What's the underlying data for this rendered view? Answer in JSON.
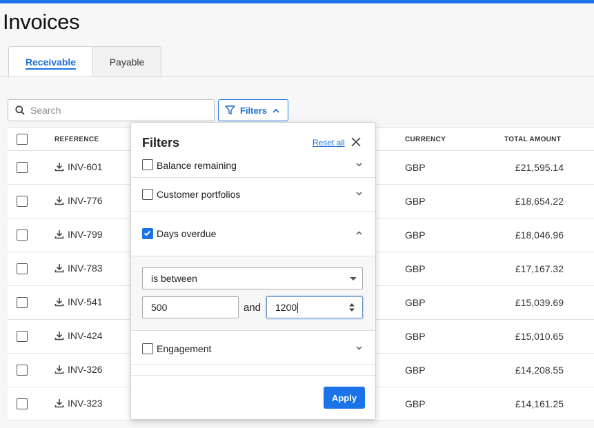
{
  "page": {
    "title": "Invoices"
  },
  "tabs": [
    {
      "label": "Receivable",
      "active": true
    },
    {
      "label": "Payable",
      "active": false
    }
  ],
  "toolbar": {
    "search_placeholder": "Search",
    "filters_label": "Filters"
  },
  "table": {
    "headers": {
      "reference": "REFERENCE",
      "currency": "CURRENCY",
      "total": "TOTAL AMOUNT"
    },
    "rows": [
      {
        "ref": "INV-601",
        "currency": "GBP",
        "amount": "£21,595.14"
      },
      {
        "ref": "INV-776",
        "currency": "GBP",
        "amount": "£18,654.22"
      },
      {
        "ref": "INV-799",
        "currency": "GBP",
        "amount": "£18,046.96"
      },
      {
        "ref": "INV-783",
        "currency": "GBP",
        "amount": "£17,167.32"
      },
      {
        "ref": "INV-541",
        "currency": "GBP",
        "amount": "£15,039.69"
      },
      {
        "ref": "INV-424",
        "currency": "GBP",
        "amount": "£15,010.65"
      },
      {
        "ref": "INV-326",
        "currency": "GBP",
        "amount": "£14,208.55"
      },
      {
        "ref": "INV-323",
        "currency": "GBP",
        "amount": "£14,161.25"
      }
    ]
  },
  "filters_panel": {
    "title": "Filters",
    "reset_label": "Reset all",
    "sections": {
      "balance": {
        "label": "Balance remaining",
        "checked": false
      },
      "portfolios": {
        "label": "Customer portfolios",
        "checked": false
      },
      "days": {
        "label": "Days overdue",
        "checked": true,
        "expanded": true
      },
      "engagement": {
        "label": "Engagement",
        "checked": false
      }
    },
    "days_overdue": {
      "operator": "is between",
      "min": "500",
      "joiner": "and",
      "max": "1200"
    },
    "apply_label": "Apply"
  },
  "colors": {
    "accent": "#1a73e8"
  }
}
